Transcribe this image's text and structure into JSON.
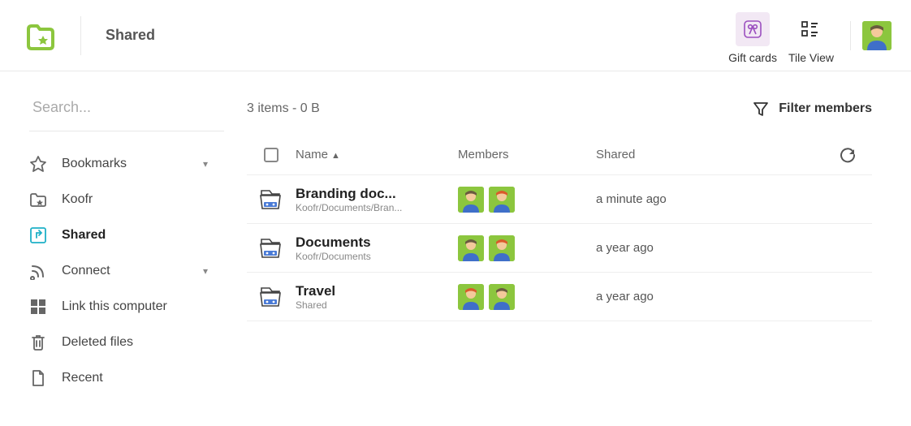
{
  "header": {
    "page_title": "Shared",
    "gift_cards_label": "Gift cards",
    "tile_view_label": "Tile View"
  },
  "search": {
    "placeholder": "Search..."
  },
  "sidebar": {
    "items": [
      {
        "label": "Bookmarks",
        "icon": "star-icon",
        "expandable": true
      },
      {
        "label": "Koofr",
        "icon": "folder-icon"
      },
      {
        "label": "Shared",
        "icon": "share-icon",
        "active": true
      },
      {
        "label": "Connect",
        "icon": "rss-icon",
        "expandable": true
      },
      {
        "label": "Link this computer",
        "icon": "grid-icon"
      },
      {
        "label": "Deleted files",
        "icon": "trash-icon"
      },
      {
        "label": "Recent",
        "icon": "page-icon"
      }
    ]
  },
  "content": {
    "count_text": "3 items - 0 B",
    "filter_label": "Filter members",
    "columns": {
      "name": "Name",
      "members": "Members",
      "shared": "Shared"
    },
    "rows": [
      {
        "name": "Branding doc...",
        "path": "Koofr/Documents/Bran...",
        "shared": "a minute ago",
        "member_colors": [
          "#6a5b3f",
          "#d95b2b"
        ]
      },
      {
        "name": "Documents",
        "path": "Koofr/Documents",
        "shared": "a year ago",
        "member_colors": [
          "#6a5b3f",
          "#d95b2b"
        ]
      },
      {
        "name": "Travel",
        "path": "Shared",
        "shared": "a year ago",
        "member_colors": [
          "#d95b2b",
          "#6a5b3f"
        ]
      }
    ]
  }
}
